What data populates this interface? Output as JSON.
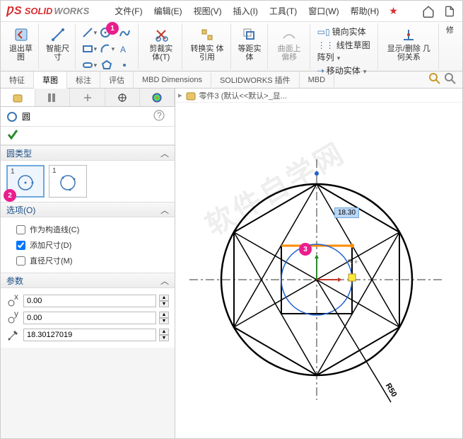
{
  "app": {
    "name": "SOLIDWORKS"
  },
  "menu": {
    "file": "文件(F)",
    "edit": "编辑(E)",
    "view": "视图(V)",
    "insert": "插入(I)",
    "tools": "工具(T)",
    "window": "窗口(W)",
    "help": "帮助(H)"
  },
  "ribbon": {
    "exit_sketch": "退出草\n图",
    "smart_dim": "智能尺\n寸",
    "trim": "剪裁实\n体(T)",
    "convert": "转换实\n体引用",
    "offset": "等距实\n体",
    "surface_offset": "曲面上\n偏移",
    "mirror": "镜向实体",
    "linear_pattern": "线性草图阵列",
    "move": "移动实体",
    "show_hide_rel": "显示/删除\n几何关系",
    "repair": "修"
  },
  "feat_tabs": [
    "特征",
    "草图",
    "标注",
    "评估",
    "MBD Dimensions",
    "SOLIDWORKS 插件",
    "MBD"
  ],
  "active_tab": 1,
  "doc_name": "零件3  (默认<<默认>_显...",
  "panel": {
    "title": "圆",
    "section_type": "圆类型",
    "type1_label": "1",
    "type2_label": "1",
    "section_opts": "选项(O)",
    "opt_construction": "作为构造线(C)",
    "opt_add_dim": "添加尺寸(D)",
    "opt_diameter": "直径尺寸(M)",
    "section_params": "参数",
    "cx": "0.00",
    "cy": "0.00",
    "radius": "18.30127019"
  },
  "canvas": {
    "dim_value": "18.30",
    "radius_label": "R50"
  },
  "checks": {
    "construction": false,
    "add_dim": true,
    "diameter": false
  }
}
